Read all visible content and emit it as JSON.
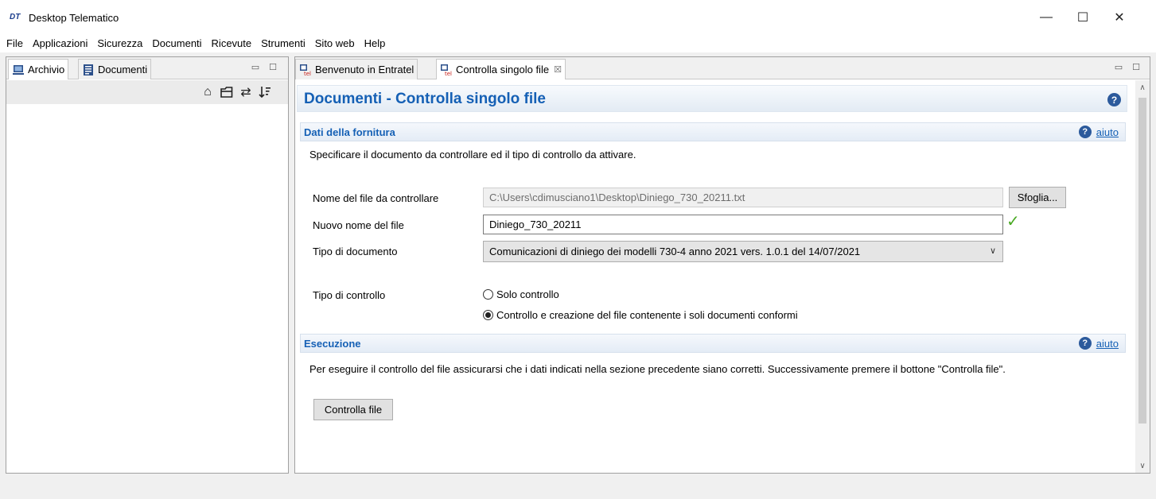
{
  "window": {
    "title": "Desktop Telematico",
    "logo": "DT",
    "controls": {
      "minimize": "—",
      "maximize": "☐",
      "close": "✕"
    }
  },
  "menu": [
    "File",
    "Applicazioni",
    "Sicurezza",
    "Documenti",
    "Ricevute",
    "Strumenti",
    "Sito web",
    "Help"
  ],
  "left_panel": {
    "tabs": [
      {
        "label": "Archivio"
      },
      {
        "label": "Documenti"
      }
    ],
    "toolbar_icons": [
      "home-icon",
      "folder-icon",
      "sync-icon",
      "sort-icon"
    ]
  },
  "right_panel": {
    "tabs": [
      {
        "label": "Benvenuto in Entratel",
        "active": false
      },
      {
        "label": "Controlla singolo file",
        "active": true,
        "close": "☒"
      }
    ],
    "page_title": "Documenti - Controlla singolo file",
    "section1": {
      "title": "Dati della fornitura",
      "help_label": "aiuto",
      "description": "Specificare il documento da controllare ed il tipo di controllo da attivare.",
      "file_label": "Nome del file da controllare",
      "file_value": "C:\\Users\\cdimusciano1\\Desktop\\Diniego_730_20211.txt",
      "browse_label": "Sfoglia...",
      "new_name_label": "Nuovo nome del file",
      "new_name_value": "Diniego_730_20211",
      "doc_type_label": "Tipo di documento",
      "doc_type_value": "Comunicazioni di diniego dei modelli 730-4 anno 2021 vers. 1.0.1 del 14/07/2021",
      "control_type_label": "Tipo di controllo",
      "options": [
        {
          "label": "Solo controllo",
          "checked": false
        },
        {
          "label": "Controllo e creazione del file contenente i soli documenti conformi",
          "checked": true
        }
      ]
    },
    "section2": {
      "title": "Esecuzione",
      "help_label": "aiuto",
      "description": "Per eseguire il controllo del file assicurarsi che i dati indicati nella sezione precedente siano corretti. Successivamente premere il bottone \"Controlla file\".",
      "button_label": "Controlla file"
    }
  },
  "colors": {
    "accent": "#1560b5",
    "valid": "#49a923"
  }
}
